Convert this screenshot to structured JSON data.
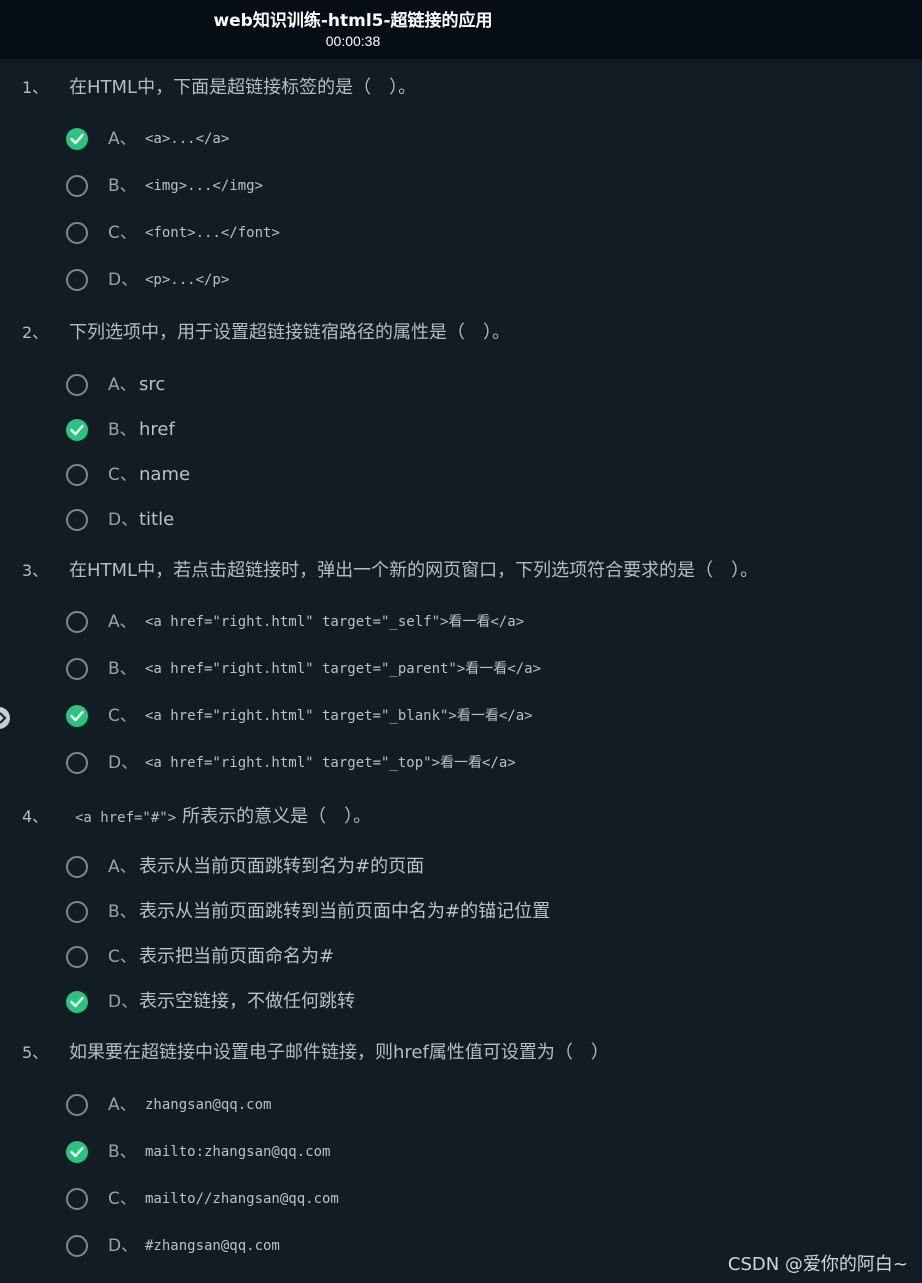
{
  "header": {
    "title": "web知识训练-html5-超链接的应用",
    "timer": "00:00:38"
  },
  "questions": [
    {
      "number": "1、",
      "text": "在HTML中，下面是超链接标签的是（　）。",
      "options": [
        {
          "letter": "A、",
          "text": "<a>...</a>",
          "checked": true
        },
        {
          "letter": "B、",
          "text": "<img>...</img>",
          "checked": false
        },
        {
          "letter": "C、",
          "text": "<font>...</font>",
          "checked": false
        },
        {
          "letter": "D、",
          "text": "<p>...</p>",
          "checked": false
        }
      ]
    },
    {
      "number": "2、",
      "text": "下列选项中，用于设置超链接链宿路径的属性是（　）。",
      "options": [
        {
          "letter": "A、",
          "text": "src",
          "checked": false
        },
        {
          "letter": "B、",
          "text": "href",
          "checked": true
        },
        {
          "letter": "C、",
          "text": "name",
          "checked": false
        },
        {
          "letter": "D、",
          "text": "title",
          "checked": false
        }
      ]
    },
    {
      "number": "3、",
      "text": "在HTML中，若点击超链接时，弹出一个新的网页窗口，下列选项符合要求的是（　）。",
      "options": [
        {
          "letter": "A、",
          "text": "<a href=\"right.html\" target=\"_self\">看一看</a>",
          "checked": false
        },
        {
          "letter": "B、",
          "text": "<a href=\"right.html\" target=\"_parent\">看一看</a>",
          "checked": false
        },
        {
          "letter": "C、",
          "text": "<a href=\"right.html\" target=\"_blank\">看一看</a>",
          "checked": true
        },
        {
          "letter": "D、",
          "text": "<a href=\"right.html\" target=\"_top\">看一看</a>",
          "checked": false
        }
      ]
    },
    {
      "number": "4、",
      "code": "<a href=\"#\">",
      "text": "所表示的意义是（　）。",
      "options": [
        {
          "letter": "A、",
          "text": "表示从当前页面跳转到名为#的页面",
          "checked": false
        },
        {
          "letter": "B、",
          "text": "表示从当前页面跳转到当前页面中名为#的锚记位置",
          "checked": false
        },
        {
          "letter": "C、",
          "text": "表示把当前页面命名为#",
          "checked": false
        },
        {
          "letter": "D、",
          "text": "表示空链接，不做任何跳转",
          "checked": true
        }
      ]
    },
    {
      "number": "5、",
      "text": "如果要在超链接中设置电子邮件链接，则href属性值可设置为（　）",
      "options": [
        {
          "letter": "A、",
          "text": "zhangsan@qq.com",
          "checked": false
        },
        {
          "letter": "B、",
          "text": "mailto:zhangsan@qq.com",
          "checked": true
        },
        {
          "letter": "C、",
          "text": "mailto//zhangsan@qq.com",
          "checked": false
        },
        {
          "letter": "D、",
          "text": "#zhangsan@qq.com",
          "checked": false
        }
      ]
    }
  ],
  "watermark": "CSDN @爱你的阿白~",
  "colors": {
    "background": "#121c25",
    "header": "#060d14",
    "checked": "#2bc47f",
    "text": "#b8c0c8"
  },
  "icons": {
    "checked": "check-icon",
    "side": "chevron-right-icon"
  }
}
